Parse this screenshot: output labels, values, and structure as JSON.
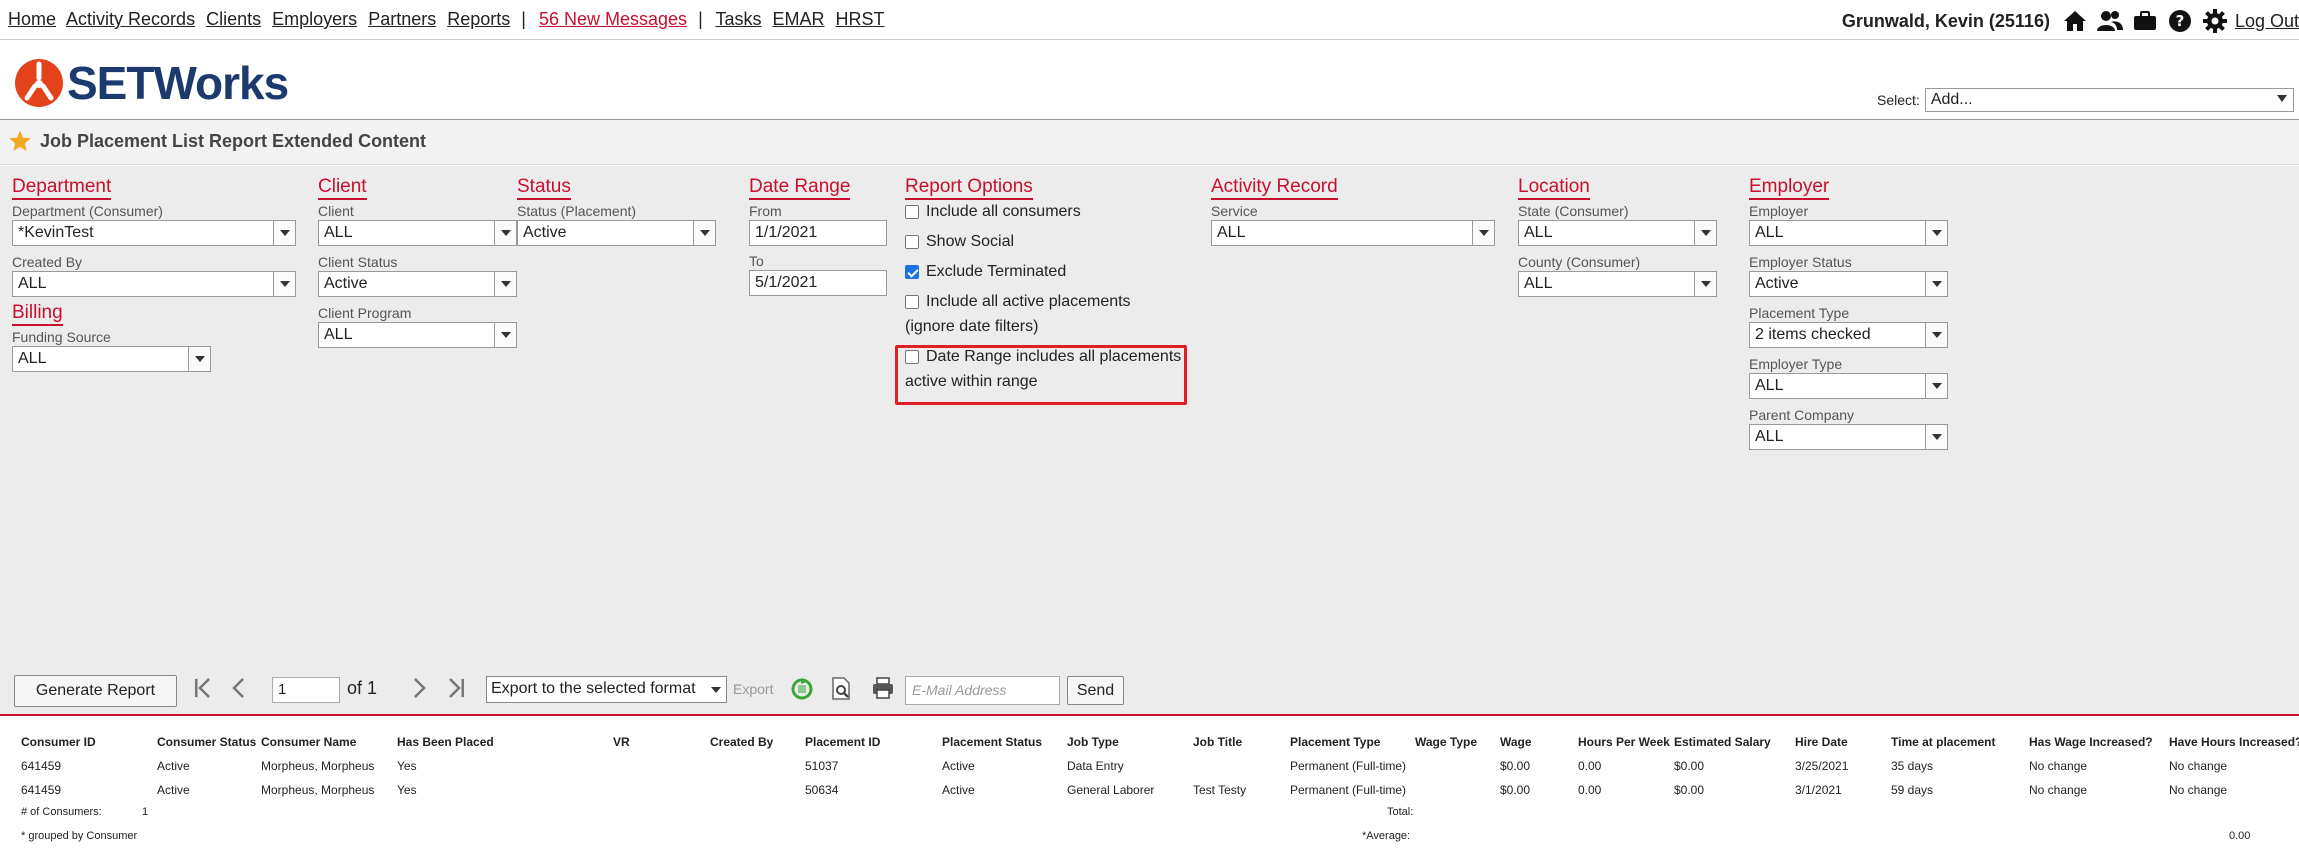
{
  "nav": {
    "links": [
      "Home",
      "Activity Records",
      "Clients",
      "Employers",
      "Partners",
      "Reports"
    ],
    "separator": "|",
    "messages": "56 New Messages",
    "links2": [
      "Tasks",
      "EMAR",
      "HRST"
    ]
  },
  "user": {
    "name": "Grunwald, Kevin  (25116)",
    "logout": "Log Out"
  },
  "brand": {
    "name": "SETWorks"
  },
  "select": {
    "label": "Select:",
    "value": "Add..."
  },
  "page_title": "Job Placement List Report Extended Content",
  "filters": {
    "department": {
      "title": "Department",
      "dept_label": "Department (Consumer)",
      "dept_value": "*KevinTest",
      "created_label": "Created By",
      "created_value": "ALL"
    },
    "billing": {
      "title": "Billing",
      "funding_label": "Funding Source",
      "funding_value": "ALL"
    },
    "client": {
      "title": "Client",
      "client_label": "Client",
      "client_value": "ALL",
      "status_label": "Client Status",
      "status_value": "Active",
      "program_label": "Client Program",
      "program_value": "ALL"
    },
    "status": {
      "title": "Status",
      "label": "Status (Placement)",
      "value": "Active"
    },
    "date_range": {
      "title": "Date Range",
      "from_label": "From",
      "from_value": "1/1/2021",
      "to_label": "To",
      "to_value": "5/1/2021"
    },
    "report_options": {
      "title": "Report Options",
      "include_all": "Include all consumers",
      "show_social": "Show Social",
      "exclude_terminated": "Exclude Terminated",
      "include_active_1": "Include all active placements",
      "include_active_2": "(ignore date filters)",
      "date_range_inc_1": "Date Range includes all placements",
      "date_range_inc_2": "active within range"
    },
    "activity": {
      "title": "Activity Record",
      "label": "Service",
      "value": "ALL"
    },
    "location": {
      "title": "Location",
      "state_label": "State (Consumer)",
      "state_value": "ALL",
      "county_label": "County (Consumer)",
      "county_value": "ALL"
    },
    "employer": {
      "title": "Employer",
      "emp_label": "Employer",
      "emp_value": "ALL",
      "status_label": "Employer Status",
      "status_value": "Active",
      "ptype_label": "Placement Type",
      "ptype_value": "2 items checked",
      "etype_label": "Employer Type",
      "etype_value": "ALL",
      "parent_label": "Parent Company",
      "parent_value": "ALL"
    }
  },
  "toolbar": {
    "generate": "Generate Report",
    "page": "1",
    "of": "of 1",
    "export_select": "Export to the selected format",
    "export": "Export",
    "email_placeholder": "E-Mail Address",
    "send": "Send"
  },
  "report": {
    "columns": [
      "Consumer ID",
      "Consumer Status",
      "Consumer Name",
      "Has Been Placed",
      "VR",
      "Created By",
      "Placement ID",
      "Placement Status",
      "Job Type",
      "Job Title",
      "Placement Type",
      "Wage Type",
      "Wage",
      "Hours Per Week",
      "Estimated Salary",
      "Hire Date",
      "Time at placement",
      "Has Wage Increased?",
      "Have Hours Increased?"
    ],
    "rows": [
      [
        "641459",
        "Active",
        "Morpheus, Morpheus",
        "Yes",
        "",
        "",
        "51037",
        "Active",
        "Data Entry",
        "",
        "Permanent (Full-time)",
        "",
        "$0.00",
        "0.00",
        "$0.00",
        "3/25/2021",
        "35 days",
        "No change",
        "No change"
      ],
      [
        "641459",
        "Active",
        "Morpheus, Morpheus",
        "Yes",
        "",
        "",
        "50634",
        "Active",
        "General Laborer",
        "Test Testy",
        "Permanent (Full-time)",
        "",
        "$0.00",
        "0.00",
        "$0.00",
        "3/1/2021",
        "59 days",
        "No change",
        "No change"
      ]
    ],
    "consumers_label": "# of Consumers:",
    "consumers_count": "1",
    "total_label": "Total:",
    "grouped_note": "* grouped by Consumer",
    "average_label": "*Average:",
    "average_value": "0.00"
  }
}
